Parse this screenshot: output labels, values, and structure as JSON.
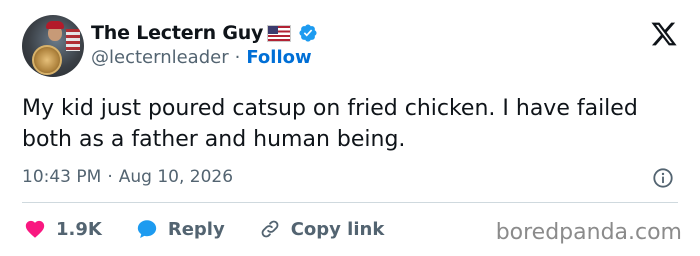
{
  "author": {
    "display_name": "The Lectern Guy",
    "handle": "@lecternleader",
    "separator": "·",
    "follow_label": "Follow"
  },
  "tweet": {
    "text": "My kid just poured catsup on fried chicken. I have failed both as a father and human being.",
    "time": "10:43 PM",
    "meta_separator": "·",
    "date": "Aug 10, 2026"
  },
  "actions": {
    "likes": "1.9K",
    "reply_label": "Reply",
    "copy_link_label": "Copy link"
  },
  "watermark": "boredpanda.com",
  "colors": {
    "like_red": "#f91880",
    "reply_blue": "#1d9bf0",
    "verified_blue": "#1d9bf0",
    "follow_blue": "#006fd6"
  },
  "icons": [
    "x-logo-icon",
    "verified-badge-icon",
    "us-flag-icon",
    "info-icon",
    "heart-icon",
    "speech-bubble-icon",
    "link-icon"
  ]
}
